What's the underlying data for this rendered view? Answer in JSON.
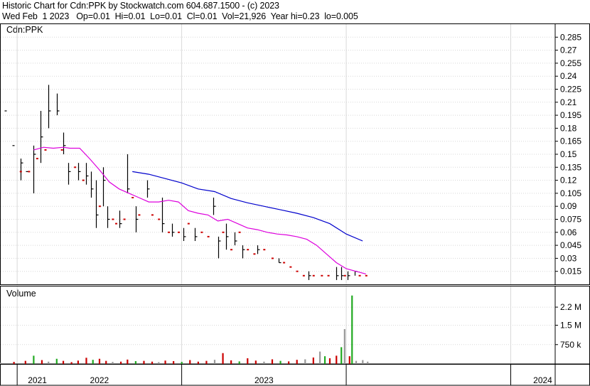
{
  "header": {
    "line1": "Historic Chart for Cdn:PPK by Stockwatch.com 604.687.1500 - (c) 2023",
    "line2": "Wed Feb  1 2023   Op=0.01  Hi=0.01  Lo=0.01  Cl=0.01  Vol=21,926  Year hi=0.23  lo=0.005"
  },
  "colors": {
    "up_bar": "#000000",
    "down_tick": "#cc0000",
    "ma_short": "#dd00dd",
    "ma_long": "#0000cc",
    "vol_up": "#22aa22",
    "vol_down": "#cc0000",
    "vol_flat": "#999999",
    "grid": "#d8d8d8"
  },
  "chart_data": [
    {
      "type": "line",
      "symbol_label": "Cdn:PPK",
      "ylim": [
        0,
        0.3
      ],
      "y_ticks": [
        "0.285",
        "0.27",
        "0.255",
        "0.24",
        "0.225",
        "0.21",
        "0.195",
        "0.18",
        "0.165",
        "0.15",
        "0.135",
        "0.12",
        "0.105",
        "0.09",
        "0.075",
        "0.06",
        "0.045",
        "0.03",
        "0.015"
      ],
      "x_labels": [
        "2021",
        "2022",
        "2023",
        "2024"
      ],
      "grid": true,
      "price_bars": [
        {
          "t": 2020.92,
          "h": 0.2,
          "l": 0.2,
          "c": 0.2
        },
        {
          "t": 2020.97,
          "h": 0.16,
          "l": 0.16,
          "c": 0.16
        },
        {
          "t": 2021.02,
          "h": 0.145,
          "l": 0.12,
          "c": 0.14
        },
        {
          "t": 2021.05,
          "h": 0.13,
          "l": 0.13,
          "c": 0.13
        },
        {
          "t": 2021.1,
          "h": 0.16,
          "l": 0.105,
          "c": 0.15
        },
        {
          "t": 2021.14,
          "h": 0.2,
          "l": 0.14,
          "c": 0.17
        },
        {
          "t": 2021.19,
          "h": 0.23,
          "l": 0.18,
          "c": 0.2
        },
        {
          "t": 2021.24,
          "h": 0.22,
          "l": 0.195,
          "c": 0.2
        },
        {
          "t": 2021.28,
          "h": 0.175,
          "l": 0.15,
          "c": 0.16
        },
        {
          "t": 2021.31,
          "h": 0.14,
          "l": 0.115,
          "c": 0.13
        },
        {
          "t": 2021.37,
          "h": 0.14,
          "l": 0.12,
          "c": 0.13
        },
        {
          "t": 2021.42,
          "h": 0.14,
          "l": 0.115,
          "c": 0.125
        },
        {
          "t": 2021.45,
          "h": 0.13,
          "l": 0.1,
          "c": 0.11
        },
        {
          "t": 2021.48,
          "h": 0.12,
          "l": 0.065,
          "c": 0.08
        },
        {
          "t": 2021.52,
          "h": 0.135,
          "l": 0.09,
          "c": 0.12
        },
        {
          "t": 2021.55,
          "h": 0.09,
          "l": 0.065,
          "c": 0.075
        },
        {
          "t": 2021.62,
          "h": 0.085,
          "l": 0.065,
          "c": 0.07
        },
        {
          "t": 2021.67,
          "h": 0.15,
          "l": 0.105,
          "c": 0.11
        },
        {
          "t": 2021.72,
          "h": 0.09,
          "l": 0.06,
          "c": 0.075
        },
        {
          "t": 2021.79,
          "h": 0.12,
          "l": 0.1,
          "c": 0.11
        },
        {
          "t": 2021.88,
          "h": 0.1,
          "l": 0.06,
          "c": 0.07
        },
        {
          "t": 2021.94,
          "h": 0.07,
          "l": 0.055,
          "c": 0.06
        },
        {
          "t": 2022.01,
          "h": 0.065,
          "l": 0.05,
          "c": 0.055
        },
        {
          "t": 2022.08,
          "h": 0.065,
          "l": 0.05,
          "c": 0.055
        },
        {
          "t": 2022.19,
          "h": 0.1,
          "l": 0.08,
          "c": 0.09
        },
        {
          "t": 2022.22,
          "h": 0.055,
          "l": 0.03,
          "c": 0.05
        },
        {
          "t": 2022.27,
          "h": 0.07,
          "l": 0.04,
          "c": 0.055
        },
        {
          "t": 2022.32,
          "h": 0.06,
          "l": 0.045,
          "c": 0.05
        },
        {
          "t": 2022.37,
          "h": 0.045,
          "l": 0.03,
          "c": 0.04
        },
        {
          "t": 2022.46,
          "h": 0.045,
          "l": 0.035,
          "c": 0.04
        },
        {
          "t": 2022.59,
          "h": 0.03,
          "l": 0.025,
          "c": 0.025
        },
        {
          "t": 2022.77,
          "h": 0.015,
          "l": 0.005,
          "c": 0.01
        },
        {
          "t": 2022.94,
          "h": 0.02,
          "l": 0.005,
          "c": 0.01
        },
        {
          "t": 2022.97,
          "h": 0.02,
          "l": 0.005,
          "c": 0.01
        },
        {
          "t": 2023.01,
          "h": 0.015,
          "l": 0.005,
          "c": 0.01
        },
        {
          "t": 2023.05,
          "h": 0.015,
          "l": 0.01,
          "c": 0.015
        }
      ],
      "ticks": [
        {
          "t": 2021.02,
          "v": 0.13
        },
        {
          "t": 2021.07,
          "v": 0.13
        },
        {
          "t": 2021.12,
          "v": 0.145
        },
        {
          "t": 2021.17,
          "v": 0.155
        },
        {
          "t": 2021.27,
          "v": 0.155
        },
        {
          "t": 2021.35,
          "v": 0.135
        },
        {
          "t": 2021.4,
          "v": 0.12
        },
        {
          "t": 2021.5,
          "v": 0.09
        },
        {
          "t": 2021.58,
          "v": 0.075
        },
        {
          "t": 2021.6,
          "v": 0.07
        },
        {
          "t": 2021.65,
          "v": 0.075
        },
        {
          "t": 2021.7,
          "v": 0.1
        },
        {
          "t": 2021.74,
          "v": 0.08
        },
        {
          "t": 2021.82,
          "v": 0.08
        },
        {
          "t": 2021.86,
          "v": 0.075
        },
        {
          "t": 2021.92,
          "v": 0.06
        },
        {
          "t": 2021.98,
          "v": 0.06
        },
        {
          "t": 2022.04,
          "v": 0.07
        },
        {
          "t": 2022.12,
          "v": 0.06
        },
        {
          "t": 2022.16,
          "v": 0.055
        },
        {
          "t": 2022.25,
          "v": 0.06
        },
        {
          "t": 2022.3,
          "v": 0.04
        },
        {
          "t": 2022.35,
          "v": 0.06
        },
        {
          "t": 2022.4,
          "v": 0.04
        },
        {
          "t": 2022.44,
          "v": 0.035
        },
        {
          "t": 2022.5,
          "v": 0.04
        },
        {
          "t": 2022.55,
          "v": 0.03
        },
        {
          "t": 2022.62,
          "v": 0.025
        },
        {
          "t": 2022.66,
          "v": 0.02
        },
        {
          "t": 2022.7,
          "v": 0.015
        },
        {
          "t": 2022.74,
          "v": 0.01
        },
        {
          "t": 2022.8,
          "v": 0.01
        },
        {
          "t": 2022.85,
          "v": 0.01
        },
        {
          "t": 2022.89,
          "v": 0.01
        },
        {
          "t": 2022.99,
          "v": 0.01
        },
        {
          "t": 2023.08,
          "v": 0.01
        },
        {
          "t": 2023.12,
          "v": 0.01
        }
      ],
      "series": [
        {
          "key": "ma_short",
          "x": [
            2021.1,
            2021.16,
            2021.22,
            2021.28,
            2021.32,
            2021.38,
            2021.44,
            2021.5,
            2021.56,
            2021.62,
            2021.68,
            2021.74,
            2021.8,
            2021.86,
            2021.92,
            2021.98,
            2022.04,
            2022.1,
            2022.16,
            2022.22,
            2022.28,
            2022.34,
            2022.4,
            2022.46,
            2022.52,
            2022.58,
            2022.64,
            2022.7,
            2022.76,
            2022.82,
            2022.88,
            2022.94,
            2023.0,
            2023.06,
            2023.12
          ],
          "values": [
            0.155,
            0.158,
            0.157,
            0.158,
            0.157,
            0.157,
            0.145,
            0.132,
            0.118,
            0.11,
            0.105,
            0.1,
            0.095,
            0.095,
            0.097,
            0.095,
            0.085,
            0.082,
            0.08,
            0.073,
            0.075,
            0.07,
            0.065,
            0.063,
            0.06,
            0.058,
            0.057,
            0.055,
            0.052,
            0.045,
            0.035,
            0.025,
            0.018,
            0.015,
            0.012
          ]
        },
        {
          "key": "ma_long",
          "x": [
            2021.7,
            2021.8,
            2021.9,
            2022.0,
            2022.1,
            2022.2,
            2022.3,
            2022.4,
            2022.5,
            2022.6,
            2022.7,
            2022.8,
            2022.9,
            2023.0,
            2023.1
          ],
          "values": [
            0.13,
            0.127,
            0.122,
            0.117,
            0.11,
            0.107,
            0.099,
            0.094,
            0.09,
            0.086,
            0.082,
            0.077,
            0.07,
            0.058,
            0.05
          ]
        }
      ]
    },
    {
      "type": "bar",
      "title": "Volume",
      "ylim": [
        0,
        3000000
      ],
      "y_ticks": [
        "2.2 M",
        "1.5 M",
        "750 k"
      ],
      "x_labels": [
        "2021",
        "2022",
        "2023",
        "2024"
      ],
      "bars": [
        {
          "t": 2020.9,
          "v": 50000,
          "c": "vol_flat"
        },
        {
          "t": 2020.98,
          "v": 80000,
          "c": "vol_down"
        },
        {
          "t": 2021.05,
          "v": 120000,
          "c": "vol_down"
        },
        {
          "t": 2021.1,
          "v": 320000,
          "c": "vol_up"
        },
        {
          "t": 2021.15,
          "v": 150000,
          "c": "vol_down"
        },
        {
          "t": 2021.19,
          "v": 90000,
          "c": "vol_flat"
        },
        {
          "t": 2021.24,
          "v": 200000,
          "c": "vol_up"
        },
        {
          "t": 2021.28,
          "v": 120000,
          "c": "vol_down"
        },
        {
          "t": 2021.33,
          "v": 70000,
          "c": "vol_down"
        },
        {
          "t": 2021.37,
          "v": 130000,
          "c": "vol_down"
        },
        {
          "t": 2021.42,
          "v": 240000,
          "c": "vol_down"
        },
        {
          "t": 2021.46,
          "v": 160000,
          "c": "vol_up"
        },
        {
          "t": 2021.5,
          "v": 200000,
          "c": "vol_down"
        },
        {
          "t": 2021.54,
          "v": 120000,
          "c": "vol_down"
        },
        {
          "t": 2021.58,
          "v": 80000,
          "c": "vol_flat"
        },
        {
          "t": 2021.63,
          "v": 90000,
          "c": "vol_down"
        },
        {
          "t": 2021.67,
          "v": 170000,
          "c": "vol_down"
        },
        {
          "t": 2021.72,
          "v": 110000,
          "c": "vol_up"
        },
        {
          "t": 2021.77,
          "v": 120000,
          "c": "vol_down"
        },
        {
          "t": 2021.82,
          "v": 90000,
          "c": "vol_down"
        },
        {
          "t": 2021.86,
          "v": 70000,
          "c": "vol_flat"
        },
        {
          "t": 2021.9,
          "v": 130000,
          "c": "vol_down"
        },
        {
          "t": 2021.95,
          "v": 110000,
          "c": "vol_down"
        },
        {
          "t": 2022.0,
          "v": 80000,
          "c": "vol_up"
        },
        {
          "t": 2022.05,
          "v": 150000,
          "c": "vol_down"
        },
        {
          "t": 2022.1,
          "v": 90000,
          "c": "vol_down"
        },
        {
          "t": 2022.15,
          "v": 120000,
          "c": "vol_down"
        },
        {
          "t": 2022.2,
          "v": 160000,
          "c": "vol_flat"
        },
        {
          "t": 2022.25,
          "v": 420000,
          "c": "vol_down"
        },
        {
          "t": 2022.3,
          "v": 140000,
          "c": "vol_down"
        },
        {
          "t": 2022.35,
          "v": 100000,
          "c": "vol_up"
        },
        {
          "t": 2022.4,
          "v": 220000,
          "c": "vol_down"
        },
        {
          "t": 2022.45,
          "v": 130000,
          "c": "vol_down"
        },
        {
          "t": 2022.5,
          "v": 90000,
          "c": "vol_flat"
        },
        {
          "t": 2022.55,
          "v": 180000,
          "c": "vol_down"
        },
        {
          "t": 2022.6,
          "v": 120000,
          "c": "vol_up"
        },
        {
          "t": 2022.65,
          "v": 100000,
          "c": "vol_down"
        },
        {
          "t": 2022.7,
          "v": 160000,
          "c": "vol_down"
        },
        {
          "t": 2022.75,
          "v": 180000,
          "c": "vol_flat"
        },
        {
          "t": 2022.8,
          "v": 250000,
          "c": "vol_down"
        },
        {
          "t": 2022.84,
          "v": 480000,
          "c": "vol_flat"
        },
        {
          "t": 2022.87,
          "v": 300000,
          "c": "vol_up"
        },
        {
          "t": 2022.9,
          "v": 220000,
          "c": "vol_down"
        },
        {
          "t": 2022.94,
          "v": 320000,
          "c": "vol_down"
        },
        {
          "t": 2022.97,
          "v": 650000,
          "c": "vol_up"
        },
        {
          "t": 2022.99,
          "v": 1350000,
          "c": "vol_flat"
        },
        {
          "t": 2023.02,
          "v": 300000,
          "c": "vol_down"
        },
        {
          "t": 2023.035,
          "v": 2650000,
          "c": "vol_up"
        },
        {
          "t": 2023.06,
          "v": 120000,
          "c": "vol_flat"
        },
        {
          "t": 2023.1,
          "v": 150000,
          "c": "vol_flat"
        },
        {
          "t": 2023.13,
          "v": 90000,
          "c": "vol_flat"
        }
      ]
    }
  ]
}
